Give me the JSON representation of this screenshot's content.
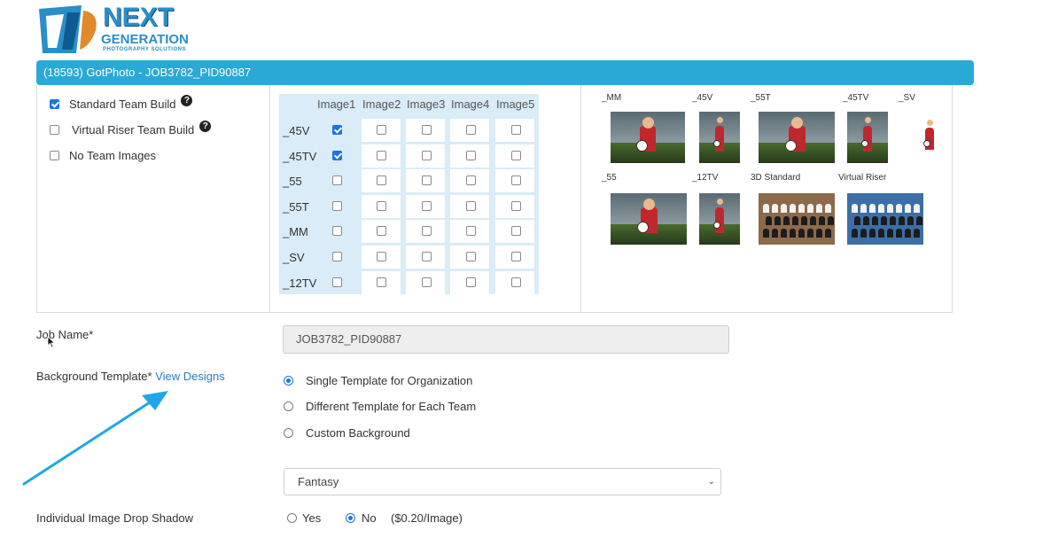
{
  "logo": {
    "line1": "NEXT",
    "line2": "GENERATION",
    "line3": "PHOTOGRAPHY SOLUTIONS"
  },
  "title_bar": "(18593) GotPhoto - JOB3782_PID90887",
  "team_options": [
    {
      "label": "Standard Team Build",
      "checked": true,
      "help": true
    },
    {
      "label": "Virtual Riser Team Build",
      "checked": false,
      "help": true
    },
    {
      "label": "No Team Images",
      "checked": false,
      "help": false
    }
  ],
  "grid": {
    "columns": [
      "Image1",
      "Image2",
      "Image3",
      "Image4",
      "Image5"
    ],
    "rows": [
      {
        "label": "_45V",
        "checks": [
          true,
          false,
          false,
          false,
          false
        ]
      },
      {
        "label": "_45TV",
        "checks": [
          true,
          false,
          false,
          false,
          false
        ]
      },
      {
        "label": "_55",
        "checks": [
          false,
          false,
          false,
          false,
          false
        ]
      },
      {
        "label": "_55T",
        "checks": [
          false,
          false,
          false,
          false,
          false
        ]
      },
      {
        "label": "_MM",
        "checks": [
          false,
          false,
          false,
          false,
          false
        ]
      },
      {
        "label": "_SV",
        "checks": [
          false,
          false,
          false,
          false,
          false
        ]
      },
      {
        "label": "_12TV",
        "checks": [
          false,
          false,
          false,
          false,
          false
        ]
      }
    ]
  },
  "previews": [
    {
      "label": "_MM"
    },
    {
      "label": "_45V"
    },
    {
      "label": "_55T"
    },
    {
      "label": "_45TV"
    },
    {
      "label": "_SV"
    },
    {
      "label": "_55"
    },
    {
      "label": "_12TV"
    },
    {
      "label": "3D Standard"
    },
    {
      "label": "Virtual Riser"
    }
  ],
  "job_name": {
    "label": "Job Name*",
    "value": "JOB3782_PID90887"
  },
  "background_template": {
    "label": "Background Template*",
    "link": "View Designs",
    "options": [
      {
        "label": "Single Template for Organization",
        "checked": true
      },
      {
        "label": "Different Template for Each Team",
        "checked": false
      },
      {
        "label": "Custom Background",
        "checked": false
      }
    ],
    "selected_design": "Fantasy"
  },
  "drop_shadow": {
    "label": "Individual Image Drop Shadow",
    "yes": "Yes",
    "no": "No",
    "selected": "No",
    "price_note": "($0.20/Image)"
  },
  "colors": {
    "accent": "#29a9d6",
    "checkbox": "#1a73e8",
    "arrow": "#1ea7e8"
  }
}
